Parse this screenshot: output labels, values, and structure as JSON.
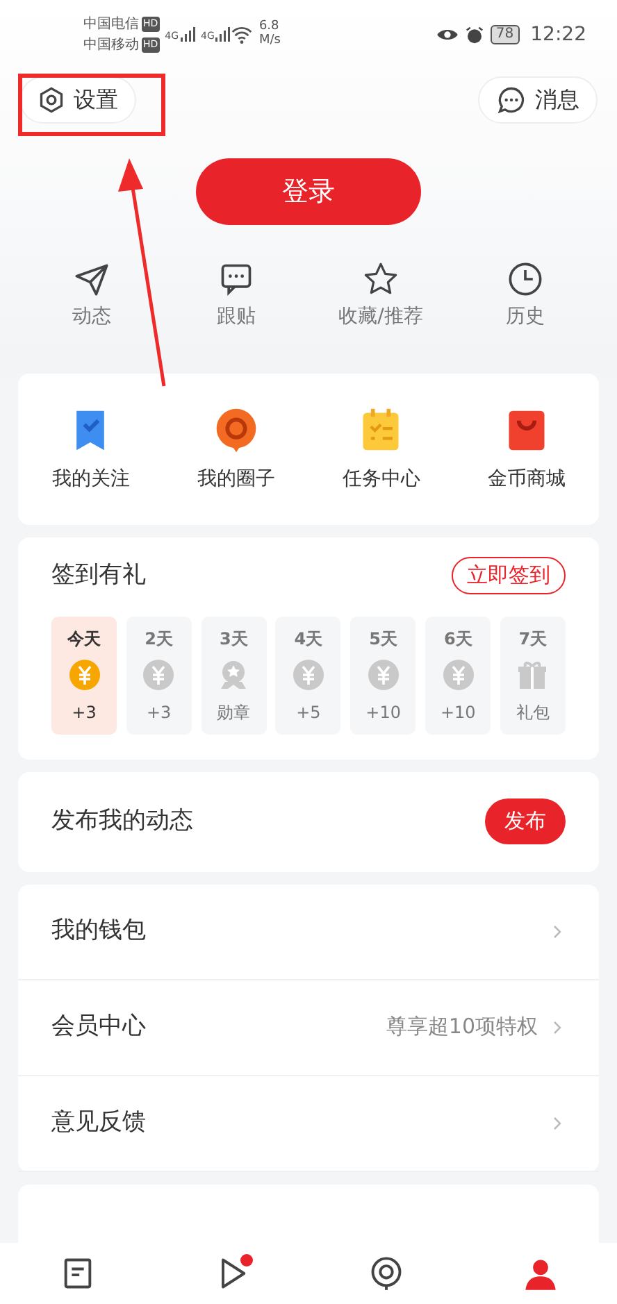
{
  "status_bar": {
    "carriers": [
      {
        "name": "中国电信",
        "badge": "HD"
      },
      {
        "name": "中国移动",
        "badge": "HD"
      }
    ],
    "network_labels": [
      "4G",
      "4G"
    ],
    "speed_value": "6.8",
    "speed_unit": "M/s",
    "battery": "78",
    "time": "12:22"
  },
  "header": {
    "settings": "设置",
    "messages": "消息",
    "login": "登录"
  },
  "annotation": {
    "highlight": true
  },
  "quick_actions": [
    {
      "kind": "send",
      "label": "动态"
    },
    {
      "kind": "chat",
      "label": "跟贴"
    },
    {
      "kind": "star",
      "label": "收藏/推荐"
    },
    {
      "kind": "clock",
      "label": "历史"
    }
  ],
  "features": [
    {
      "kind": "bookmark",
      "label": "我的关注"
    },
    {
      "kind": "bubble",
      "label": "我的圈子"
    },
    {
      "kind": "tasks",
      "label": "任务中心"
    },
    {
      "kind": "bag",
      "label": "金币商城"
    }
  ],
  "checkin": {
    "title": "签到有礼",
    "button": "立即签到",
    "days": [
      {
        "day": "今天",
        "kind": "coin",
        "reward": "+3",
        "selected": true
      },
      {
        "day": "2天",
        "kind": "coin",
        "reward": "+3",
        "selected": false
      },
      {
        "day": "3天",
        "kind": "medal",
        "reward": "勋章",
        "selected": false
      },
      {
        "day": "4天",
        "kind": "coin",
        "reward": "+5",
        "selected": false
      },
      {
        "day": "5天",
        "kind": "coin",
        "reward": "+10",
        "selected": false
      },
      {
        "day": "6天",
        "kind": "coin",
        "reward": "+10",
        "selected": false
      },
      {
        "day": "7天",
        "kind": "gift",
        "reward": "礼包",
        "selected": false
      }
    ]
  },
  "publish": {
    "title": "发布我的动态",
    "button": "发布"
  },
  "menu": [
    {
      "label": "我的钱包"
    },
    {
      "label": "会员中心",
      "detail": "尊享超10项特权"
    },
    {
      "label": "意见反馈"
    }
  ],
  "bottom_tabs": [
    {
      "kind": "news",
      "selected": false,
      "dot": false
    },
    {
      "kind": "video",
      "selected": false,
      "dot": true
    },
    {
      "kind": "circle",
      "selected": false,
      "dot": false
    },
    {
      "kind": "profile",
      "selected": true,
      "dot": false
    }
  ]
}
